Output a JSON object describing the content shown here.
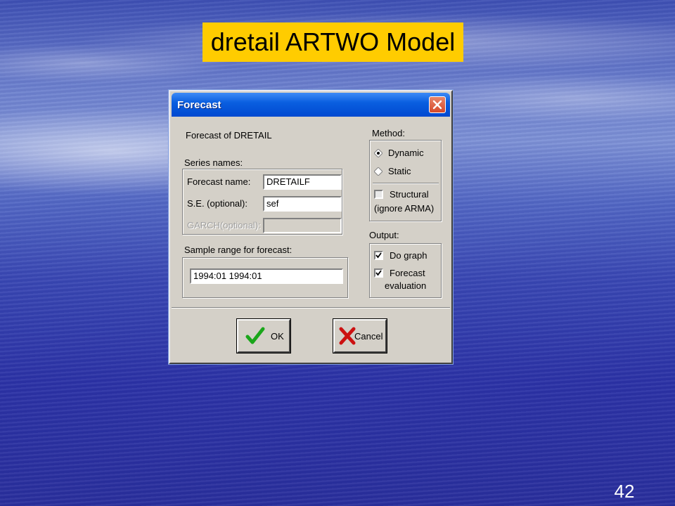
{
  "slide": {
    "title": "dretail  ARTWO Model",
    "page_number": "42",
    "title_bg": "#ffcc00"
  },
  "dialog": {
    "title": "Forecast",
    "close_icon": "close-icon",
    "forecast_of": "Forecast of DRETAIL",
    "series_names_label": "Series names:",
    "forecast_name_label": "Forecast name:",
    "forecast_name_value": "DRETAILF",
    "se_label": "S.E. (optional):",
    "se_value": "sef",
    "garch_label": "GARCH(optional):",
    "garch_value": "",
    "sample_range_label": "Sample range for forecast:",
    "sample_range_value": "1994:01 1994:01",
    "method_label": "Method:",
    "method_options": [
      {
        "label": "Dynamic",
        "selected": true
      },
      {
        "label": "Static",
        "selected": false
      }
    ],
    "structural_label": "Structural",
    "structural_sub": "(ignore ARMA)",
    "structural_checked": false,
    "output_label": "Output:",
    "output_options": [
      {
        "label": "Do graph",
        "checked": true
      },
      {
        "label": "Forecast",
        "label2": "evaluation",
        "checked": true
      }
    ],
    "ok_label": "OK",
    "cancel_label": "Cancel",
    "ok_icon": "check-icon",
    "cancel_icon": "x-icon"
  }
}
